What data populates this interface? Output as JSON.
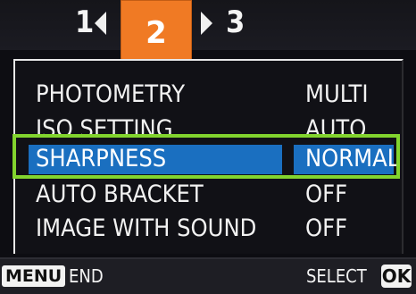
{
  "tabs": {
    "left": "1",
    "active": "2",
    "right": "3"
  },
  "menu": {
    "items": [
      {
        "label": "PHOTOMETRY",
        "value": "MULTI"
      },
      {
        "label": "ISO SETTING",
        "value": "AUTO"
      },
      {
        "label": "SHARPNESS",
        "value": "NORMAL",
        "selected": true
      },
      {
        "label": "AUTO BRACKET",
        "value": "OFF"
      },
      {
        "label": "IMAGE WITH SOUND",
        "value": "OFF"
      }
    ]
  },
  "footer": {
    "menu_key": "MENU",
    "menu_action": "END",
    "select_label": "SELECT",
    "ok_key": "OK"
  },
  "colors": {
    "accent_tab": "#f07a24",
    "selection_bar": "#1a6fc0",
    "highlight_frame": "#82d42e"
  }
}
